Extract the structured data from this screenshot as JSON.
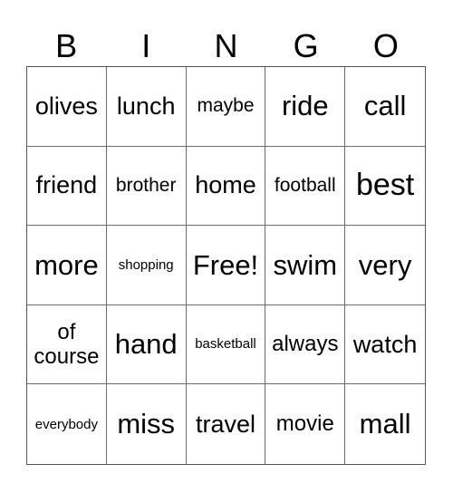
{
  "card": {
    "header": [
      "B",
      "I",
      "N",
      "G",
      "O"
    ],
    "rows": [
      [
        "olives",
        "lunch",
        "maybe",
        "ride",
        "call"
      ],
      [
        "friend",
        "brother",
        "home",
        "football",
        "best"
      ],
      [
        "more",
        "shopping",
        "Free!",
        "swim",
        "very"
      ],
      [
        "of course",
        "hand",
        "basketball",
        "always",
        "watch"
      ],
      [
        "everybody",
        "miss",
        "travel",
        "movie",
        "mall"
      ]
    ],
    "free_space": "Free!"
  }
}
